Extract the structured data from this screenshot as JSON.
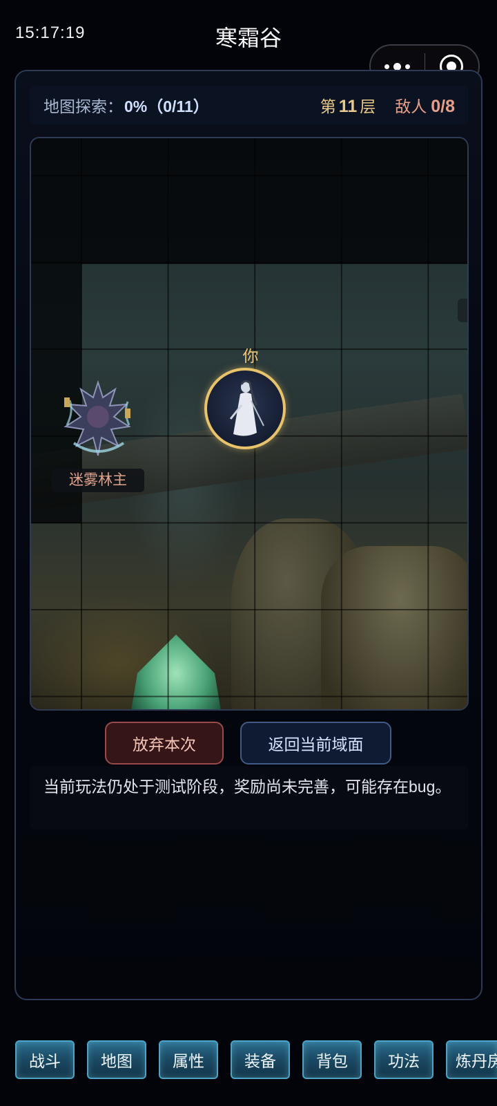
{
  "status": {
    "time": "15:17:19"
  },
  "page": {
    "title": "寒霜谷"
  },
  "info": {
    "explore_label": "地图探索：",
    "explore_value": "0%（0/11）",
    "floor_prefix": "第",
    "floor_number": "11",
    "floor_suffix": "层",
    "enemy_label": "敌人",
    "enemy_value": "0/8"
  },
  "map": {
    "player_label": "你",
    "enemy_name": "迷雾林主"
  },
  "actions": {
    "abandon": "放弃本次",
    "return": "返回当前域面"
  },
  "notice": "当前玩法仍处于测试阶段，奖励尚未完善，可能存在bug。",
  "tabs": [
    {
      "label": "战斗"
    },
    {
      "label": "地图"
    },
    {
      "label": "属性"
    },
    {
      "label": "装备"
    },
    {
      "label": "背包"
    },
    {
      "label": "功法"
    },
    {
      "label": "炼丹房"
    }
  ],
  "colors": {
    "accent_gold": "#e8c36c",
    "enemy_text": "#e6a08a",
    "tab_border": "#4aa5c8",
    "abandon_bg": "#361518",
    "return_bg": "#0f1b33"
  }
}
